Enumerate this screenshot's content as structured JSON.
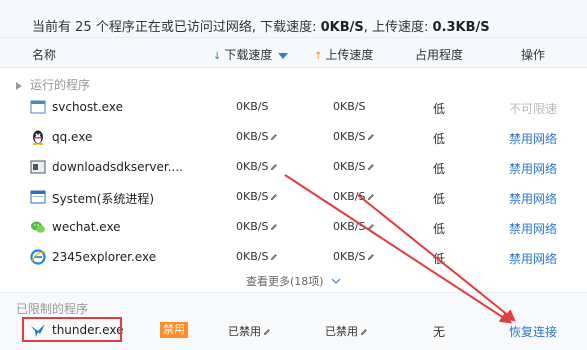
{
  "summary": {
    "prefix": "当前有 ",
    "count": "25",
    "mid": " 个程序正在或已访问过网络, 下载速度: ",
    "down": "0KB/S",
    "mid2": ", 上传速度: ",
    "up": "0.3KB/S"
  },
  "header": {
    "name": "名称",
    "down": "下载速度",
    "up": "上传速度",
    "usage": "占用程度",
    "action": "操作"
  },
  "running_label": "运行的程序",
  "rows": [
    {
      "icon": "window-icon",
      "name": "svchost.exe",
      "down": "0KB/S",
      "up": "0KB/S",
      "usage": "低",
      "action": "不可限速",
      "action_disabled": true
    },
    {
      "icon": "qq-penguin-icon",
      "name": "qq.exe",
      "down": "0KB/S",
      "up": "0KB/S",
      "usage": "低",
      "action": "禁用网络",
      "action_disabled": false
    },
    {
      "icon": "app-window-icon",
      "name": "downloadsdkserver....",
      "down": "0KB/S",
      "up": "0KB/S",
      "usage": "低",
      "action": "禁用网络",
      "action_disabled": false
    },
    {
      "icon": "system-window-icon",
      "name": "System(系统进程)",
      "down": "0KB/S",
      "up": "0KB/S",
      "usage": "低",
      "action": "禁用网络",
      "action_disabled": false
    },
    {
      "icon": "wechat-icon",
      "name": "wechat.exe",
      "down": "0KB/S",
      "up": "0KB/S",
      "usage": "低",
      "action": "禁用网络",
      "action_disabled": false
    },
    {
      "icon": "ie-browser-icon",
      "name": "2345explorer.exe",
      "down": "0KB/S",
      "up": "0KB/S",
      "usage": "低",
      "action": "禁用网络",
      "action_disabled": false
    }
  ],
  "more": "查看更多(18项)",
  "limited_label": "已限制的程序",
  "limited_row": {
    "icon": "thunder-bird-icon",
    "name": "thunder.exe",
    "badge": "禁用",
    "down": "已禁用",
    "up": "已禁用",
    "usage": "无",
    "action": "恢复连接"
  },
  "colors": {
    "accent": "#2b78d0",
    "badge": "#ff8c2a",
    "highlight": "#e23c3c"
  }
}
